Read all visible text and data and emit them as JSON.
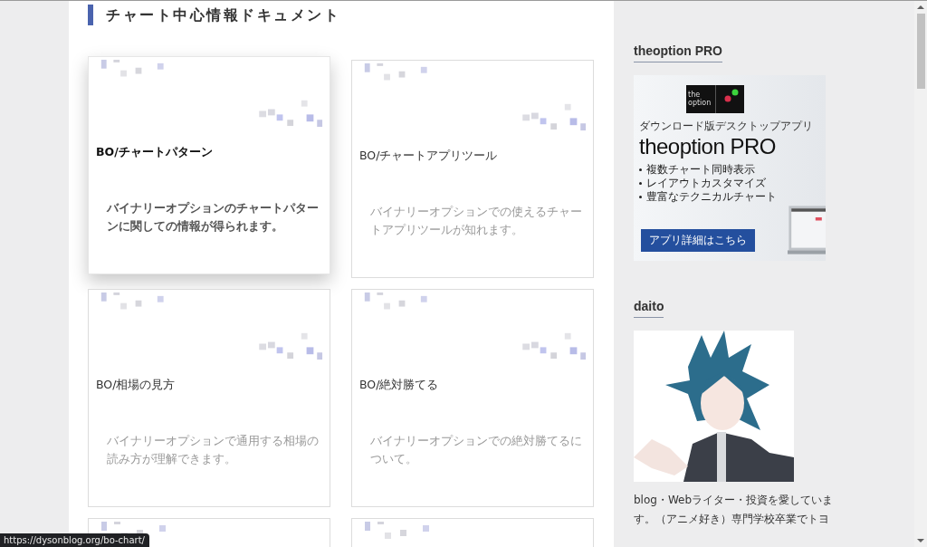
{
  "section": {
    "title": "チャート中心情報ドキュメント"
  },
  "cards": [
    {
      "kind": "full",
      "title": "BO/チャートパターン",
      "description": "バイナリーオプションのチャートパターンに関しての情報が得られます。",
      "hovered": true
    },
    {
      "kind": "full",
      "title": "BO/チャートアプリツール",
      "description": "バイナリーオプションでの使えるチャートアプリツールが知れます。",
      "hovered": false
    },
    {
      "kind": "full",
      "title": "BO/相場の見方",
      "description": "バイナリーオプションで通用する相場の読み方が理解できます。",
      "hovered": false
    },
    {
      "kind": "full",
      "title": "BO/絶対勝てる",
      "description": "バイナリーオプションでの絶対勝てるについて。",
      "hovered": false
    },
    {
      "kind": "partial",
      "hovered": false
    },
    {
      "kind": "partial",
      "hovered": false
    }
  ],
  "sidebar": {
    "widgets": [
      {
        "kind": "banner",
        "title": "theoption PRO",
        "banner": {
          "logo_top": "the",
          "logo_bottom": "option",
          "tagline": "ダウンロード版デスクトップアプリ",
          "product": "theoption PRO",
          "features": [
            "複数チャート同時表示",
            "レイアウトカスタマイズ",
            "豊富なテクニカルチャート"
          ],
          "button": "アプリ詳細はこちら"
        }
      },
      {
        "kind": "profile",
        "title": "daito",
        "bio_lines": [
          "blog・Webライター・投資を愛していま",
          "す。（アニメ好き）専門学校卒業でトヨ"
        ]
      }
    ]
  },
  "status_bar": {
    "url": "https://dysonblog.org/bo-chart/"
  }
}
